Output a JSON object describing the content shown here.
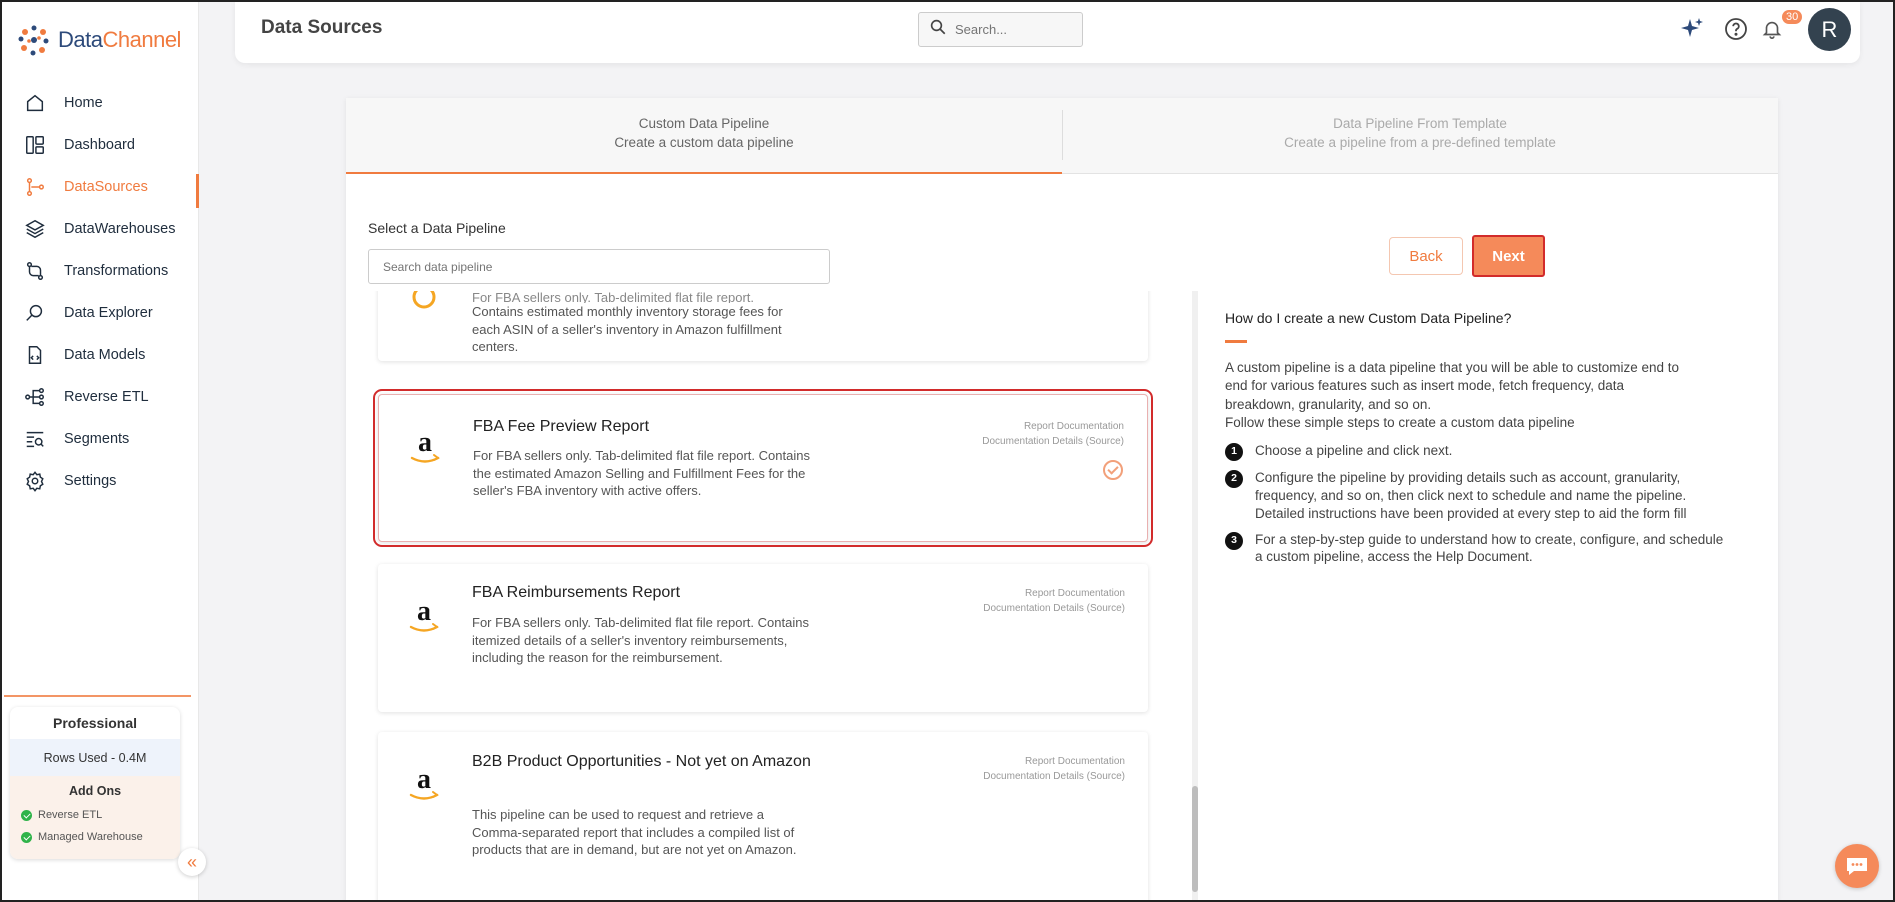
{
  "app": {
    "logo_part1": "Data",
    "logo_part2": "Channel"
  },
  "sidebar": {
    "items": [
      {
        "label": "Home",
        "icon": "home-icon"
      },
      {
        "label": "Dashboard",
        "icon": "dashboard-icon"
      },
      {
        "label": "DataSources",
        "icon": "datasources-icon",
        "active": true
      },
      {
        "label": "DataWarehouses",
        "icon": "layers-icon"
      },
      {
        "label": "Transformations",
        "icon": "transform-icon"
      },
      {
        "label": "Data Explorer",
        "icon": "explorer-icon"
      },
      {
        "label": "Data Models",
        "icon": "models-icon"
      },
      {
        "label": "Reverse ETL",
        "icon": "reverse-etl-icon"
      },
      {
        "label": "Segments",
        "icon": "segments-icon"
      },
      {
        "label": "Settings",
        "icon": "gear-icon"
      }
    ],
    "plan": {
      "name": "Professional",
      "rows_used": "Rows Used - 0.4M",
      "addons_title": "Add Ons",
      "addons": [
        "Reverse ETL",
        "Managed Warehouse"
      ]
    }
  },
  "header": {
    "title": "Data Sources",
    "search_placeholder": "Search...",
    "notification_count": "30",
    "avatar_initial": "R"
  },
  "tabs": [
    {
      "title": "Custom Data Pipeline",
      "subtitle": "Create a custom data pipeline",
      "active": true
    },
    {
      "title": "Data Pipeline From Template",
      "subtitle": "Create a pipeline from a pre-defined template",
      "active": false
    }
  ],
  "select": {
    "label": "Select a Data Pipeline",
    "search_placeholder": "Search data pipeline",
    "back_label": "Back",
    "next_label": "Next"
  },
  "pipelines": [
    {
      "title": "",
      "description_partial": "For FBA sellers only. Tab-delimited flat file report.",
      "description": "Contains estimated monthly inventory storage fees for each ASIN of a seller's inventory in Amazon fulfillment centers."
    },
    {
      "title": "FBA Fee Preview Report",
      "description": "For FBA sellers only. Tab-delimited flat file report. Contains the estimated Amazon Selling and Fulfillment Fees for the seller's FBA inventory with active offers.",
      "link1": "Report Documentation",
      "link2": "Documentation Details (Source)",
      "selected": true
    },
    {
      "title": "FBA Reimbursements Report",
      "description": "For FBA sellers only. Tab-delimited flat file report. Contains itemized details of a seller's inventory reimbursements, including the reason for the reimbursement.",
      "link1": "Report Documentation",
      "link2": "Documentation Details (Source)"
    },
    {
      "title": "B2B Product Opportunities - Not yet on Amazon",
      "description": "This pipeline can be used to request and retrieve a Comma-separated report that includes a compiled list of products that are in demand, but are not yet on Amazon.",
      "link1": "Report Documentation",
      "link2": "Documentation Details (Source)"
    }
  ],
  "help": {
    "title": "How do I create a new Custom Data Pipeline?",
    "intro": "A custom pipeline is a data pipeline that you will be able to customize end to end for various features such as insert mode, fetch frequency, data breakdown, granularity, and so on.",
    "intro2": "Follow these simple steps to create a custom data pipeline",
    "steps": [
      {
        "num": "1",
        "text": "Choose a pipeline and click next."
      },
      {
        "num": "2",
        "text": "Configure the pipeline by providing details such as account, granularity, frequency, and so on, then click next to schedule and name the pipeline. Detailed instructions have been provided at every step to aid the form fill"
      },
      {
        "num": "3",
        "text": "For a step-by-step guide to understand how to create, configure, and schedule a custom pipeline, access the Help Document."
      }
    ]
  },
  "colors": {
    "accent": "#f07b3f",
    "brand_dark": "#2d4a7a",
    "selected_outline": "#d22b2b"
  }
}
